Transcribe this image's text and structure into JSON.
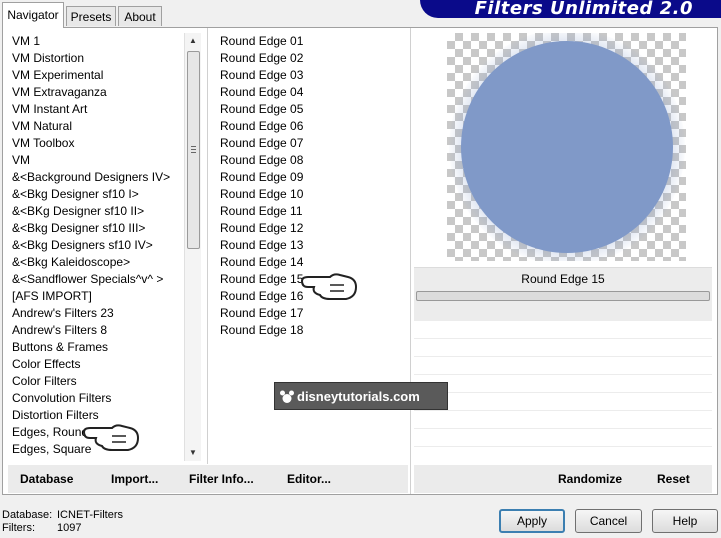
{
  "tabs": [
    {
      "label": "Navigator",
      "active": true
    },
    {
      "label": "Presets",
      "active": false
    },
    {
      "label": "About",
      "active": false
    }
  ],
  "banner_title": "Filters Unlimited 2.0",
  "categories": [
    "VM 1",
    "VM Distortion",
    "VM Experimental",
    "VM Extravaganza",
    "VM Instant Art",
    "VM Natural",
    "VM Toolbox",
    "VM",
    "&<Background Designers IV>",
    "&<Bkg Designer sf10 I>",
    "&<BKg Designer sf10 II>",
    "&<Bkg Designer sf10 III>",
    "&<Bkg Designers sf10 IV>",
    "&<Bkg Kaleidoscope>",
    "&<Sandflower Specials^v^ >",
    "[AFS IMPORT]",
    "Andrew's Filters 23",
    "Andrew's Filters 8",
    "Buttons & Frames",
    "Color Effects",
    "Color Filters",
    "Convolution Filters",
    "Distortion Filters",
    "Edges, Round",
    "Edges, Square"
  ],
  "filters": [
    "Round Edge 01",
    "Round Edge 02",
    "Round Edge 03",
    "Round Edge 04",
    "Round Edge 05",
    "Round Edge 06",
    "Round Edge 07",
    "Round Edge 08",
    "Round Edge 09",
    "Round Edge 10",
    "Round Edge 11",
    "Round Edge 12",
    "Round Edge 13",
    "Round Edge 14",
    "Round Edge 15",
    "Round Edge 16",
    "Round Edge 17",
    "Round Edge 18"
  ],
  "selected_filter": "Round Edge 15",
  "preview_color": "#8099c8",
  "toolbar": {
    "database": "Database",
    "import": "Import...",
    "filter_info": "Filter Info...",
    "editor": "Editor...",
    "randomize": "Randomize",
    "reset": "Reset"
  },
  "status": {
    "database_label": "Database:",
    "database_value": "ICNET-Filters",
    "filters_label": "Filters:",
    "filters_value": "1097"
  },
  "buttons": {
    "apply": "Apply",
    "cancel": "Cancel",
    "help": "Help"
  },
  "watermark": "disneytutorials.com",
  "icons": {
    "pointer": "pointing-hand-icon",
    "logo": "mickey-icon"
  }
}
